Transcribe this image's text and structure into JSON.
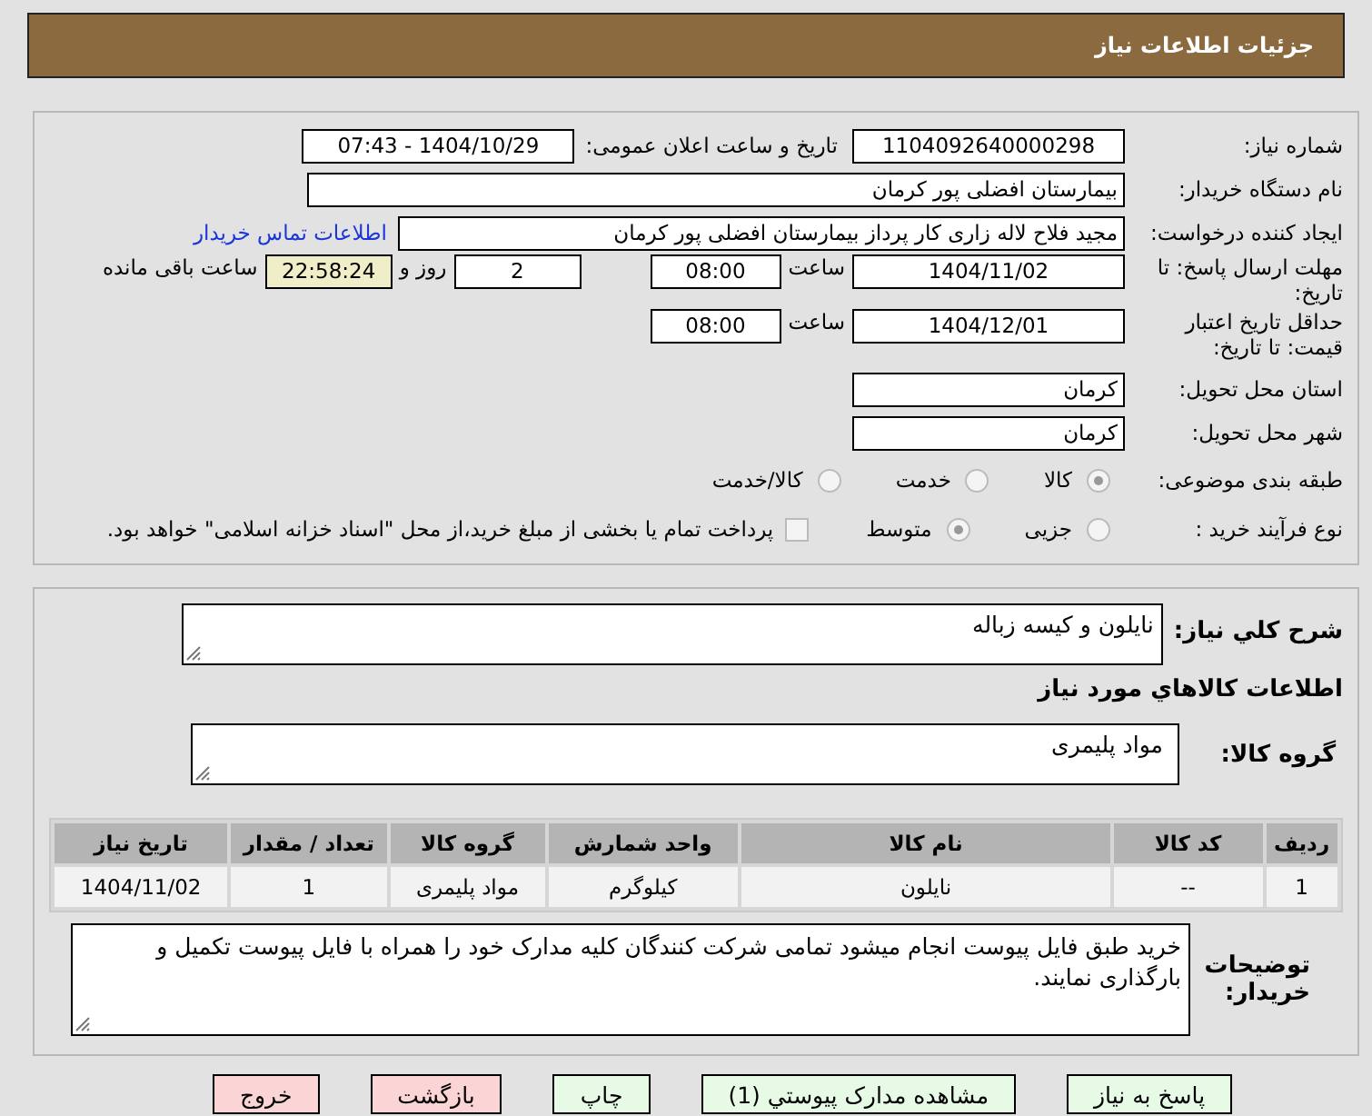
{
  "header": {
    "title": "جزئیات اطلاعات نیاز"
  },
  "info": {
    "need_number": {
      "label": "شماره نیاز:",
      "value": "1104092640000298"
    },
    "announce": {
      "label": "تاریخ و ساعت اعلان عمومی:",
      "value": "1404/10/29 - 07:43"
    },
    "buyer": {
      "label": "نام دستگاه خریدار:",
      "value": "بیمارستان افضلی پور کرمان"
    },
    "creator": {
      "label": "ایجاد کننده درخواست:",
      "value": "مجید فلاح لاله زاری کار پرداز بیمارستان افضلی پور کرمان",
      "link": "اطلاعات تماس خریدار"
    },
    "deadline": {
      "label": "مهلت ارسال پاسخ: تا تاریخ:",
      "date": "1404/11/02",
      "time_label": "ساعت",
      "time": "08:00",
      "days": "2",
      "days_label": "روز و",
      "remaining": "22:58:24",
      "remaining_label": "ساعت باقی مانده"
    },
    "validity": {
      "label": "حداقل تاریخ اعتبار قیمت: تا تاریخ:",
      "date": "1404/12/01",
      "time_label": "ساعت",
      "time": "08:00"
    },
    "province": {
      "label": "استان محل تحویل:",
      "value": "کرمان"
    },
    "city": {
      "label": "شهر محل تحویل:",
      "value": "کرمان"
    },
    "category": {
      "label": "طبقه بندی موضوعی:",
      "options": [
        {
          "label": "کالا",
          "selected": true
        },
        {
          "label": "خدمت",
          "selected": false
        },
        {
          "label": "کالا/خدمت",
          "selected": false
        }
      ]
    },
    "process": {
      "label": "نوع فرآیند خرید :",
      "options": [
        {
          "label": "جزیی",
          "selected": false
        },
        {
          "label": "متوسط",
          "selected": true
        }
      ],
      "treasury": {
        "checked": false,
        "label": "پرداخت تمام یا بخشی از مبلغ خرید،از محل \"اسناد خزانه اسلامی\" خواهد بود."
      }
    }
  },
  "details": {
    "description": {
      "label": "شرح کلي نیاز:",
      "value": "نایلون و کیسه زباله"
    },
    "goods_heading": "اطلاعات کالاهاي مورد نیاز",
    "goods_group": {
      "label": "گروه کالا:",
      "value": "مواد پلیمری"
    },
    "table": {
      "columns": [
        "ردیف",
        "کد کالا",
        "نام کالا",
        "واحد شمارش",
        "گروه کالا",
        "تعداد / مقدار",
        "تاریخ نیاز"
      ],
      "rows": [
        [
          "1",
          "--",
          "نایلون",
          "کیلوگرم",
          "مواد پلیمری",
          "1",
          "1404/11/02"
        ]
      ]
    },
    "buyer_notes": {
      "label": "توضیحات خریدار:",
      "value": "خرید طبق فایل پیوست انجام میشود تمامی شرکت کنندگان کلیه مدارک خود را همراه با فایل پیوست تکمیل و بارگذاری نمایند."
    }
  },
  "buttons": [
    {
      "label": "پاسخ به نیاز",
      "kind": "accept"
    },
    {
      "label": "مشاهده مدارک پیوستي (1)",
      "kind": "accept"
    },
    {
      "label": "چاپ",
      "kind": "accept"
    },
    {
      "label": "بازگشت",
      "kind": "exit"
    },
    {
      "label": "خروج",
      "kind": "exit"
    }
  ]
}
